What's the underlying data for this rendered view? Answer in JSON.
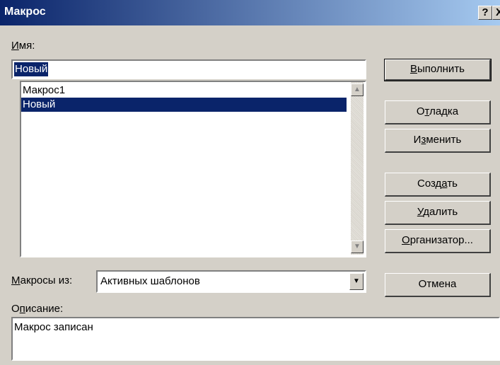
{
  "window": {
    "title": "Макрос",
    "help_btn": "?",
    "close_btn": "X"
  },
  "name_label": {
    "u": "И",
    "rest": "мя:"
  },
  "name_input": {
    "value": "Новый"
  },
  "macro_list": {
    "items": [
      {
        "label": "Макрос1"
      },
      {
        "label": "Новый"
      }
    ],
    "selected": "Новый"
  },
  "buttons": {
    "run": {
      "u": "В",
      "rest": "ыполнить"
    },
    "debug": {
      "pre": "О",
      "u": "т",
      "rest": "ладка"
    },
    "edit": {
      "pre": "И",
      "u": "з",
      "rest": "менить"
    },
    "create": {
      "pre": "Созд",
      "u": "а",
      "rest": "ть"
    },
    "delete": {
      "u": "У",
      "rest": "далить"
    },
    "organizer": {
      "u": "О",
      "rest": "рганизатор..."
    },
    "cancel": {
      "label": "Отмена"
    }
  },
  "macros_from_label": {
    "u": "М",
    "rest": "акросы из:"
  },
  "macros_from_select": {
    "value": "Активных шаблонов"
  },
  "description_label": {
    "pre": "О",
    "u": "п",
    "rest": "исание:"
  },
  "description": {
    "value": "Макрос записан"
  },
  "icons": {
    "scroll_up": "up-arrow",
    "scroll_down": "down-arrow",
    "dropdown": "down-arrow"
  }
}
